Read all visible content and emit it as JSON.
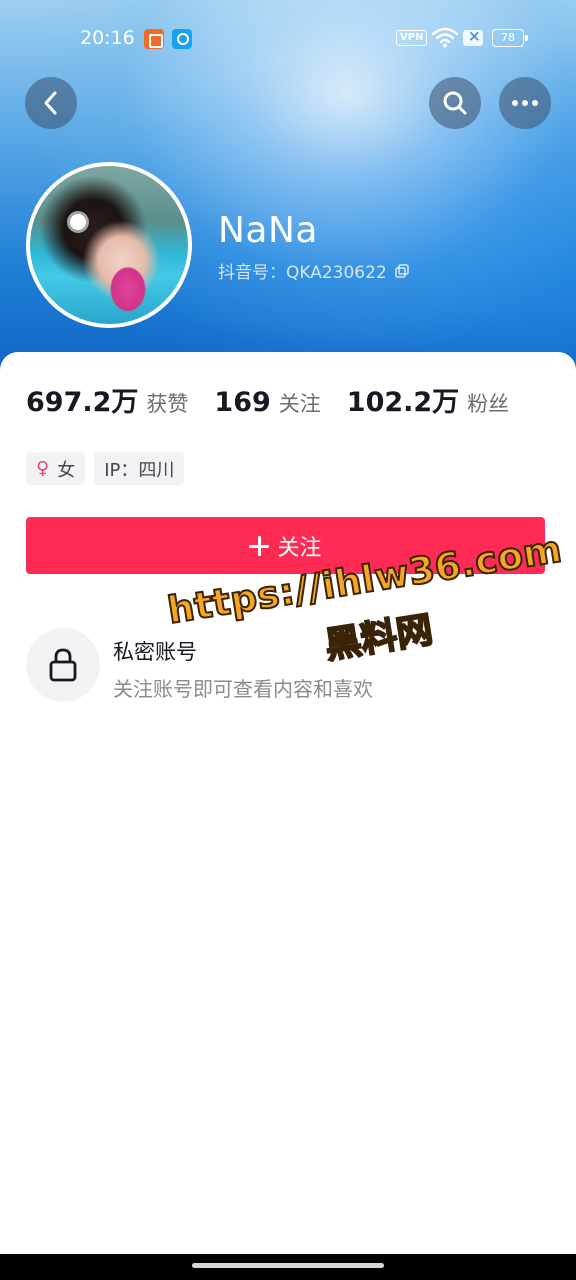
{
  "status_bar": {
    "time": "20:16",
    "vpn_label": "VPN",
    "battery_level": "78",
    "icons": [
      "app-notification-icon",
      "search-app-notification-icon",
      "wifi-icon",
      "sim-off-icon",
      "battery-icon"
    ]
  },
  "top_bar": {
    "back_icon": "chevron-left-icon",
    "search_icon": "search-icon",
    "more_icon": "ellipsis-icon"
  },
  "profile": {
    "name": "NaNa",
    "douyin_id": "抖音号：QKA230622",
    "copy_icon": "copy-icon"
  },
  "stats": [
    {
      "value": "697.2万",
      "label": "获赞"
    },
    {
      "value": "169",
      "label": "关注"
    },
    {
      "value": "102.2万",
      "label": "粉丝"
    }
  ],
  "tags": {
    "gender_icon": "female-icon",
    "gender_symbol": "♀",
    "gender": "女",
    "ip": "IP：四川"
  },
  "follow_button": {
    "label": "关注",
    "color": "#fe2c55"
  },
  "private_account": {
    "title": "私密账号",
    "description": "关注账号即可查看内容和喜欢"
  },
  "watermark": {
    "url": "https://ihlw36.com",
    "name": "黑料网"
  }
}
